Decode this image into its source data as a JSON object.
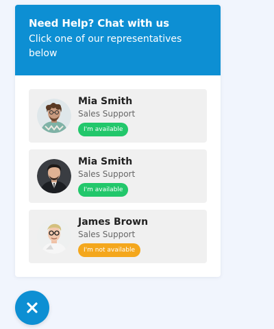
{
  "header": {
    "title": "Need Help? Chat with us",
    "subtitle": "Click one of our representatives below"
  },
  "representatives": [
    {
      "name": "Mia Smith",
      "role": "Sales Support",
      "status": "I'm available",
      "status_color": "#22c76b"
    },
    {
      "name": "Mia Smith",
      "role": "Sales Support",
      "status": "I'm available",
      "status_color": "#22c76b"
    },
    {
      "name": "James Brown",
      "role": "Sales Support",
      "status": "I'm not available",
      "status_color": "#f4a71d"
    }
  ],
  "colors": {
    "header_background": "#0d8fd3",
    "close_button_background": "#0d8fd3",
    "page_background": "#f1f5fd"
  },
  "icons": {
    "close": "close-icon"
  }
}
